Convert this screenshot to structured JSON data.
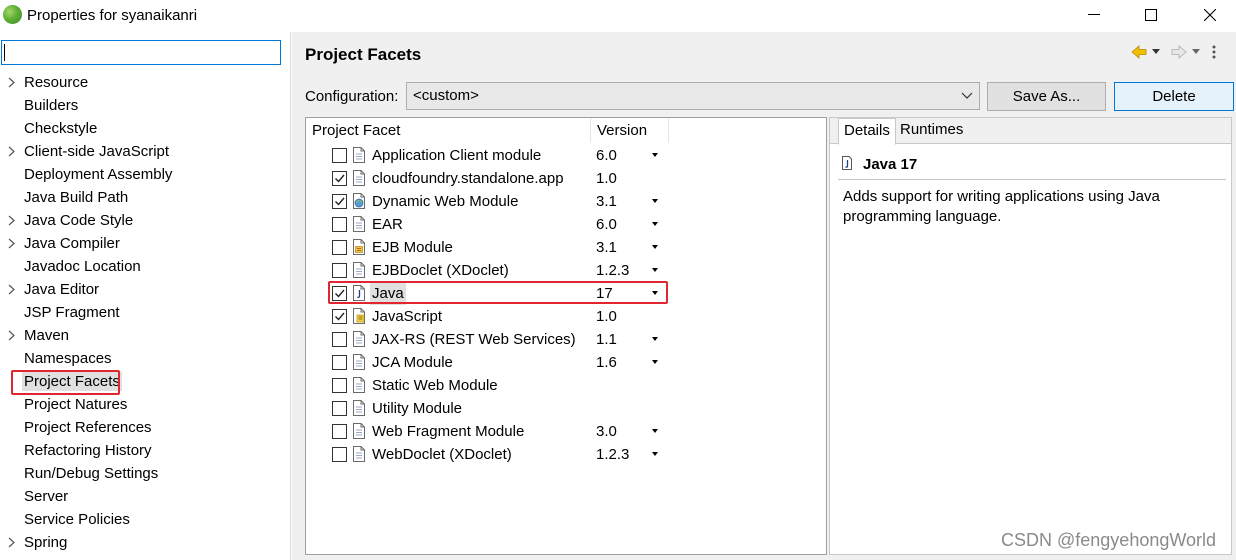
{
  "window": {
    "title": "Properties for syanaikanri"
  },
  "filter": {
    "value": ""
  },
  "sidebar": {
    "items": [
      {
        "label": "Resource",
        "expandable": true
      },
      {
        "label": "Builders",
        "expandable": false
      },
      {
        "label": "Checkstyle",
        "expandable": false
      },
      {
        "label": "Client-side JavaScript",
        "expandable": true
      },
      {
        "label": "Deployment Assembly",
        "expandable": false
      },
      {
        "label": "Java Build Path",
        "expandable": false
      },
      {
        "label": "Java Code Style",
        "expandable": true
      },
      {
        "label": "Java Compiler",
        "expandable": true
      },
      {
        "label": "Javadoc Location",
        "expandable": false
      },
      {
        "label": "Java Editor",
        "expandable": true
      },
      {
        "label": "JSP Fragment",
        "expandable": false
      },
      {
        "label": "Maven",
        "expandable": true
      },
      {
        "label": "Namespaces",
        "expandable": false
      },
      {
        "label": "Project Facets",
        "expandable": false,
        "selected": true
      },
      {
        "label": "Project Natures",
        "expandable": false
      },
      {
        "label": "Project References",
        "expandable": false
      },
      {
        "label": "Refactoring History",
        "expandable": false
      },
      {
        "label": "Run/Debug Settings",
        "expandable": false
      },
      {
        "label": "Server",
        "expandable": false
      },
      {
        "label": "Service Policies",
        "expandable": false
      },
      {
        "label": "Spring",
        "expandable": true
      }
    ]
  },
  "main": {
    "title": "Project Facets",
    "configuration_label": "Configuration:",
    "configuration_value": "<custom>",
    "save_as_label": "Save As...",
    "delete_label": "Delete",
    "table": {
      "headers": [
        "Project Facet",
        "Version"
      ],
      "rows": [
        {
          "name": "Application Client module",
          "checked": false,
          "version": "6.0",
          "dropdown": true,
          "icon": "document-icon"
        },
        {
          "name": "cloudfoundry.standalone.app",
          "checked": true,
          "version": "1.0",
          "dropdown": false,
          "icon": "document-icon"
        },
        {
          "name": "Dynamic Web Module",
          "checked": true,
          "version": "3.1",
          "dropdown": true,
          "icon": "web-module-icon"
        },
        {
          "name": "EAR",
          "checked": false,
          "version": "6.0",
          "dropdown": true,
          "icon": "document-icon"
        },
        {
          "name": "EJB Module",
          "checked": false,
          "version": "3.1",
          "dropdown": true,
          "icon": "ejb-module-icon"
        },
        {
          "name": "EJBDoclet (XDoclet)",
          "checked": false,
          "version": "1.2.3",
          "dropdown": true,
          "icon": "document-icon"
        },
        {
          "name": "Java",
          "checked": true,
          "version": "17",
          "dropdown": true,
          "icon": "java-icon",
          "selected": true
        },
        {
          "name": "JavaScript",
          "checked": true,
          "version": "1.0",
          "dropdown": false,
          "icon": "javascript-icon"
        },
        {
          "name": "JAX-RS (REST Web Services)",
          "checked": false,
          "version": "1.1",
          "dropdown": true,
          "icon": "document-icon"
        },
        {
          "name": "JCA Module",
          "checked": false,
          "version": "1.6",
          "dropdown": true,
          "icon": "document-icon"
        },
        {
          "name": "Static Web Module",
          "checked": false,
          "version": "",
          "dropdown": false,
          "icon": "document-icon"
        },
        {
          "name": "Utility Module",
          "checked": false,
          "version": "",
          "dropdown": false,
          "icon": "document-icon"
        },
        {
          "name": "Web Fragment Module",
          "checked": false,
          "version": "3.0",
          "dropdown": true,
          "icon": "document-icon"
        },
        {
          "name": "WebDoclet (XDoclet)",
          "checked": false,
          "version": "1.2.3",
          "dropdown": true,
          "icon": "document-icon"
        }
      ]
    }
  },
  "details": {
    "tabs": [
      "Details",
      "Runtimes"
    ],
    "active_tab": "Details",
    "title": "Java 17",
    "description": "Adds support for writing applications using Java programming language."
  },
  "watermark": "CSDN @fengyehongWorld",
  "colors": {
    "highlight_red": "#e0262e",
    "selection_gray": "#e0e0e0",
    "focus_blue": "#0078d7"
  }
}
